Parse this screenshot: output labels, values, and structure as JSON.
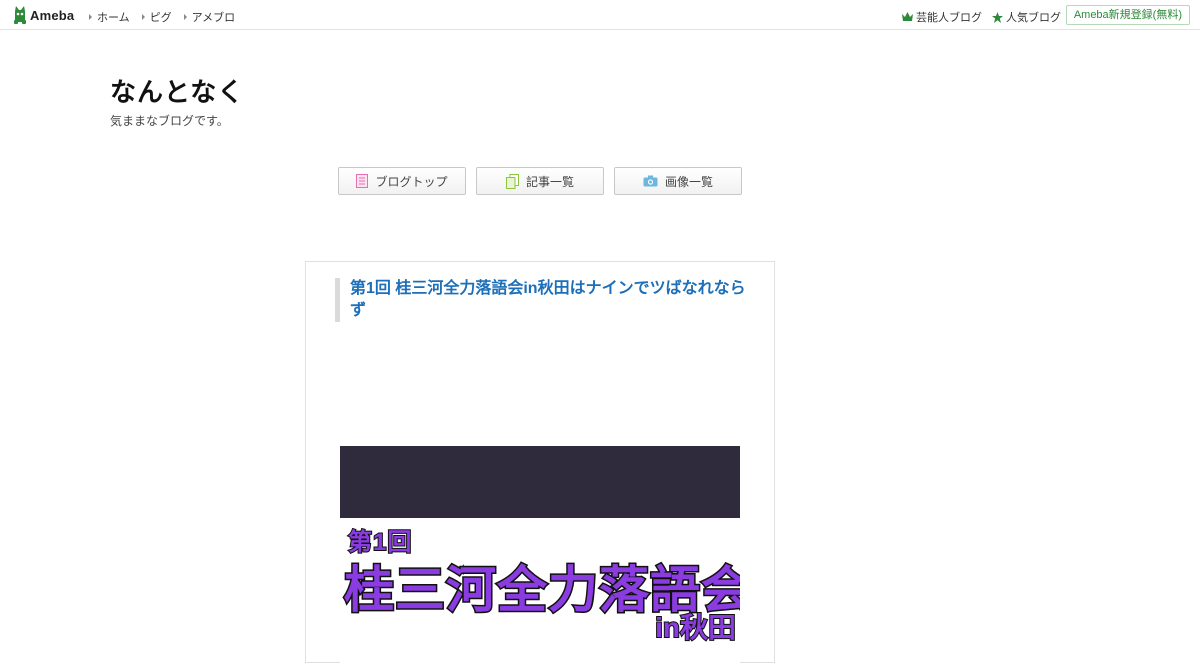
{
  "header": {
    "logo_text": "Ameba",
    "nav": [
      {
        "label": "ホーム"
      },
      {
        "label": "ピグ"
      },
      {
        "label": "アメブロ"
      }
    ],
    "right_links": [
      {
        "label": "芸能人ブログ",
        "icon": "crown-icon"
      },
      {
        "label": "人気ブログ",
        "icon": "star-icon"
      }
    ],
    "register_label": "Ameba新規登録(無料)"
  },
  "blog": {
    "title": "なんとなく",
    "description": "気ままなブログです。"
  },
  "tabs": [
    {
      "label": "ブログトップ",
      "icon": "document-icon",
      "color": "#e66fb0"
    },
    {
      "label": "記事一覧",
      "icon": "pages-icon",
      "color": "#8cc63f"
    },
    {
      "label": "画像一覧",
      "icon": "camera-icon",
      "color": "#6bb7de"
    }
  ],
  "entry": {
    "title": "第1回 桂三河全力落語会in秋田はナインでツばなれならず",
    "image_text": {
      "line1": "第1回",
      "line2": "桂三河全力落語会",
      "line3": "in秋田"
    }
  },
  "colors": {
    "brand_green": "#2d8a39",
    "link_blue": "#1c6fb8",
    "poster_purple": "#8a3ce0"
  }
}
